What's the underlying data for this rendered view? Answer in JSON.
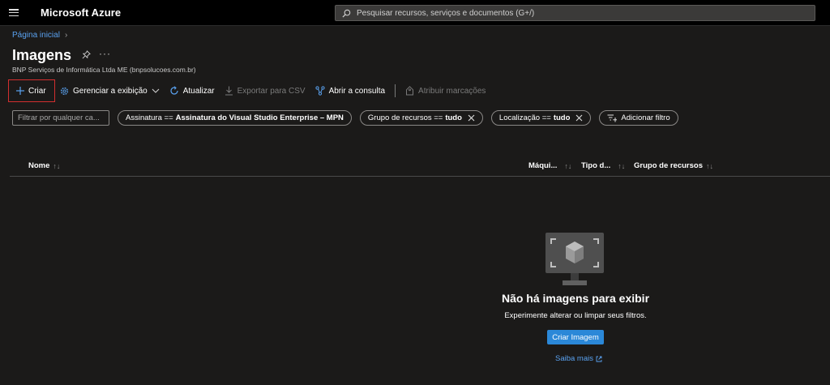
{
  "app": {
    "brand": "Microsoft Azure"
  },
  "search": {
    "placeholder": "Pesquisar recursos, serviços e documentos (G+/)"
  },
  "breadcrumb": {
    "home": "Página inicial"
  },
  "page": {
    "title": "Imagens",
    "subtitle": "BNP Serviços de Informática Ltda ME (bnpsolucoes.com.br)",
    "more": "···"
  },
  "toolbar": {
    "create": "Criar",
    "manage_view": "Gerenciar a exibição",
    "refresh": "Atualizar",
    "export_csv": "Exportar para CSV",
    "open_query": "Abrir a consulta",
    "assign_tags": "Atribuir marcações"
  },
  "filters": {
    "input_placeholder": "Filtrar por qualquer ca...",
    "subscription": {
      "label": "Assinatura ==",
      "value": "Assinatura do Visual Studio Enterprise – MPN"
    },
    "resource_group": {
      "label": "Grupo de recursos ==",
      "value": "tudo"
    },
    "location": {
      "label": "Localização ==",
      "value": "tudo"
    },
    "add_filter": "Adicionar filtro"
  },
  "table": {
    "columns": [
      "Nome",
      "Máqui...",
      "Tipo d...",
      "Grupo de recursos"
    ]
  },
  "empty": {
    "title": "Não há imagens para exibir",
    "subtitle": "Experimente alterar ou limpar seus filtros.",
    "button": "Criar Imagem",
    "learn_more": "Saiba mais"
  },
  "colors": {
    "accent": "#2b88d8",
    "link": "#5aa2f0",
    "highlight_border": "#d32f2f",
    "background": "#1b1a19"
  },
  "icons": [
    "hamburger-icon",
    "search-icon",
    "pin-icon",
    "plus-icon",
    "gear-icon",
    "chevron-down-icon",
    "refresh-icon",
    "download-icon",
    "query-icon",
    "tag-icon",
    "close-icon",
    "add-filter-icon",
    "sort-icon",
    "image-monitor-icon",
    "external-link-icon"
  ]
}
